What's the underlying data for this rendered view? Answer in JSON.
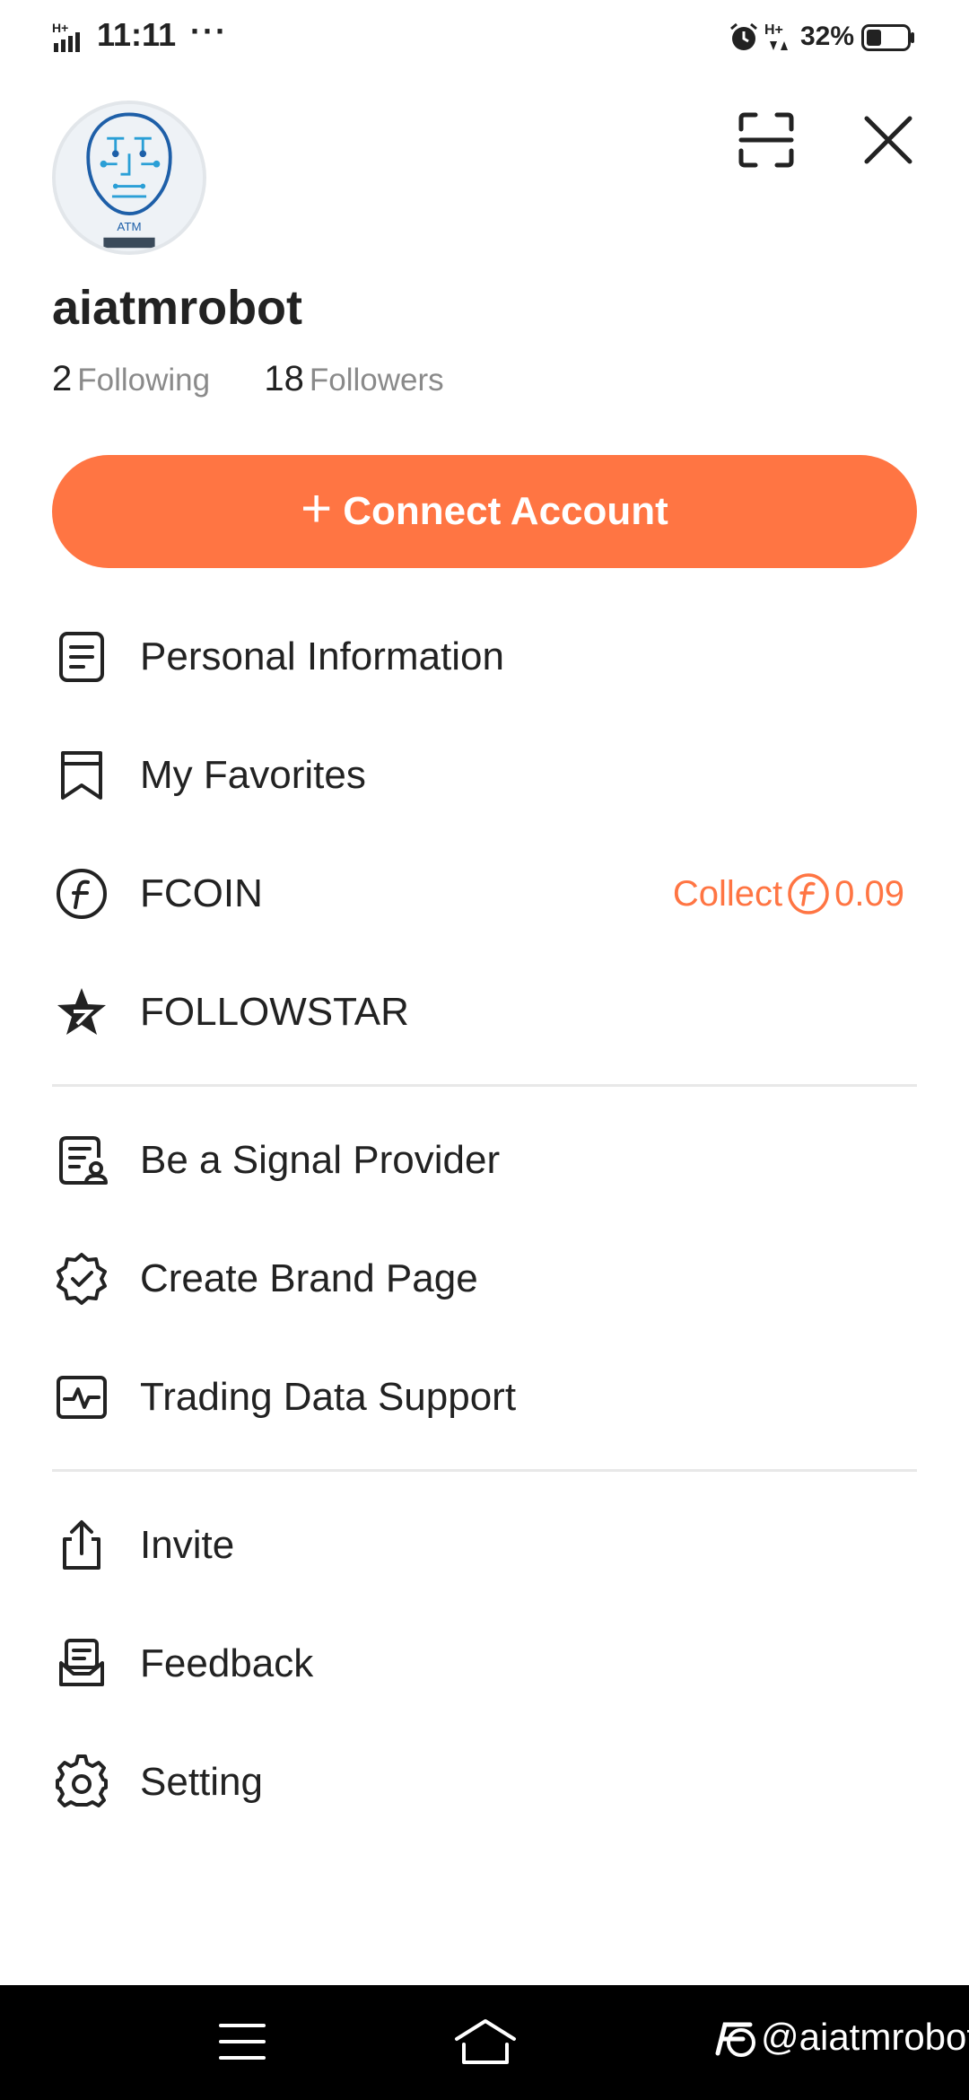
{
  "status_bar": {
    "time": "11:11",
    "dots": "···",
    "battery": "32%"
  },
  "header": {
    "avatar_text": "ATM",
    "username": "aiatmrobot",
    "following_count": "2",
    "following_label": "Following",
    "followers_count": "18",
    "followers_label": "Followers"
  },
  "connect_button": {
    "plus": "+",
    "label": "Connect Account",
    "color": "#ff7543"
  },
  "menu": {
    "personal_info": "Personal Information",
    "favorites": "My Favorites",
    "fcoin": "FCOIN",
    "fcoin_collect": "Collect",
    "fcoin_value": "0.09",
    "followstar": "FOLLOWSTAR",
    "signal_provider": "Be a Signal Provider",
    "brand_page": "Create Brand Page",
    "trading_data": "Trading Data Support",
    "invite": "Invite",
    "feedback": "Feedback",
    "setting": "Setting"
  },
  "bottom_nav": {
    "watermark": "@aiatmrobot"
  }
}
